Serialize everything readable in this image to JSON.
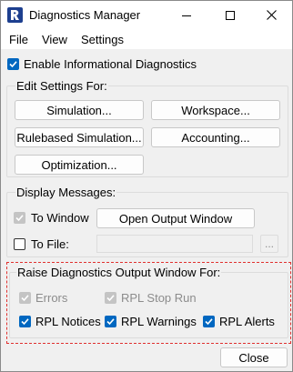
{
  "window": {
    "title": "Diagnostics Manager",
    "accent_color": "#0067c0",
    "highlight_color": "#e0302e"
  },
  "menubar": {
    "items": [
      "File",
      "View",
      "Settings"
    ]
  },
  "enable_informational": {
    "label": "Enable Informational Diagnostics",
    "checked": true
  },
  "edit_settings": {
    "title": "Edit Settings For:",
    "buttons": [
      "Simulation...",
      "Workspace...",
      "Rulebased Simulation...",
      "Accounting...",
      "Optimization..."
    ]
  },
  "display_messages": {
    "title": "Display Messages:",
    "to_window_label": "To Window",
    "to_window_checked": true,
    "to_window_disabled": true,
    "open_output_window_label": "Open Output Window",
    "to_file_label": "To File:",
    "to_file_checked": false,
    "file_path_value": "",
    "browse_label": "..."
  },
  "raise_window": {
    "title": "Raise Diagnostics Output Window For:",
    "options": [
      {
        "label": "Errors",
        "checked": true,
        "disabled": true
      },
      {
        "label": "RPL Stop Run",
        "checked": true,
        "disabled": true
      },
      {
        "label": "RPL Notices",
        "checked": true,
        "disabled": false
      },
      {
        "label": "RPL Warnings",
        "checked": true,
        "disabled": false
      },
      {
        "label": "RPL Alerts",
        "checked": true,
        "disabled": false
      }
    ]
  },
  "footer": {
    "close_label": "Close"
  }
}
